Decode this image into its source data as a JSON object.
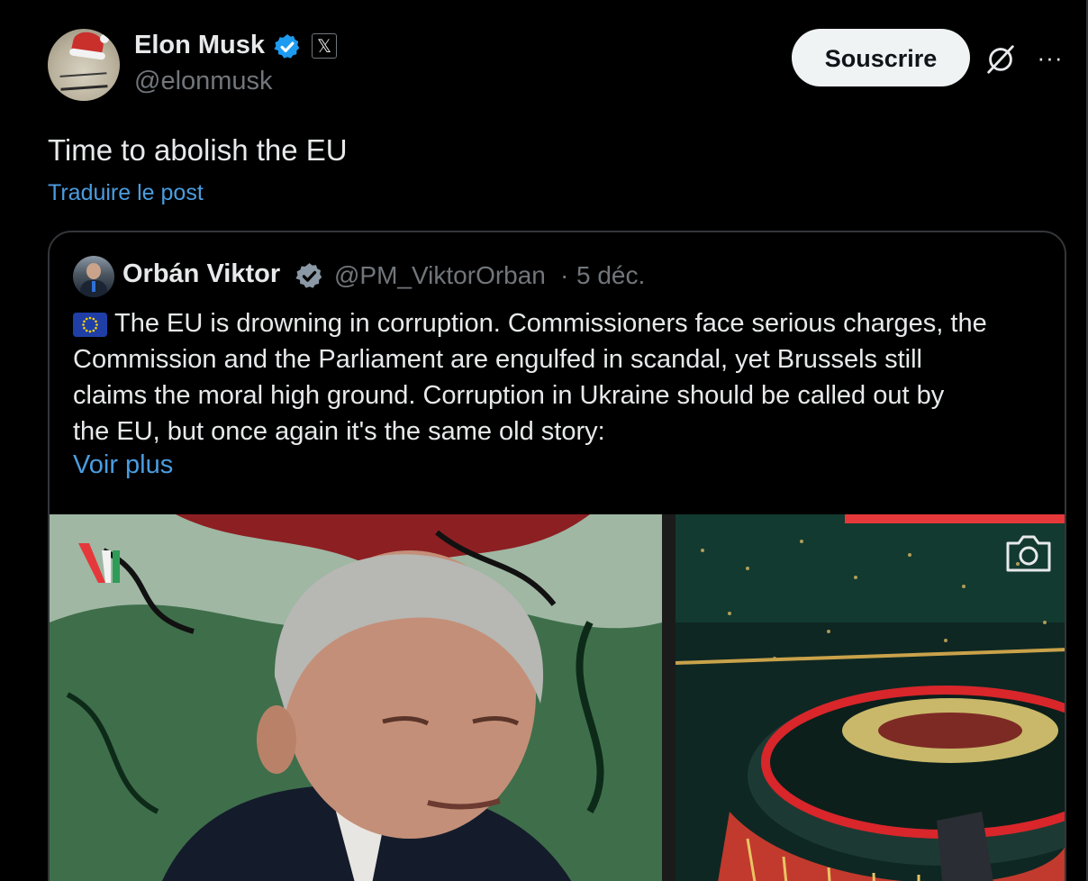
{
  "tweet": {
    "author_name": "Elon Musk",
    "author_handle": "@elonmusk",
    "subscribe_label": "Souscrire",
    "more_icon_glyph": "···",
    "x_badge_glyph": "𝕏",
    "text": "Time to abolish the EU",
    "translate_label": "Traduire le post",
    "icons": {
      "verified": "verified-badge-icon",
      "x_affiliate": "x-logo-icon",
      "grok": "grok-icon",
      "more": "more-options-icon"
    }
  },
  "quoted": {
    "author_name": "Orbán Viktor",
    "author_handle": "@PM_ViktorOrban",
    "separator": "·",
    "date": "5 déc.",
    "body_lines": [
      "The EU is drowning in corruption. Commissioners face serious charges, the",
      "Commission and the Parliament are engulfed in scandal, yet Brussels still",
      "claims the moral high ground. Corruption in Ukraine should be called out by",
      "the EU, but once again it's the same old story:"
    ],
    "show_more_label": "Voir plus",
    "icons": {
      "flag": "eu-flag-icon",
      "camera": "camera-icon",
      "channel_logo": "channel-logo-icon"
    }
  },
  "colors": {
    "background": "#000000",
    "text": "#e7e9ea",
    "muted": "#71767b",
    "link": "#4a9de0",
    "verified": "#1d9bf0",
    "button_bg": "#eff3f4",
    "accent_red": "#e5383b"
  }
}
